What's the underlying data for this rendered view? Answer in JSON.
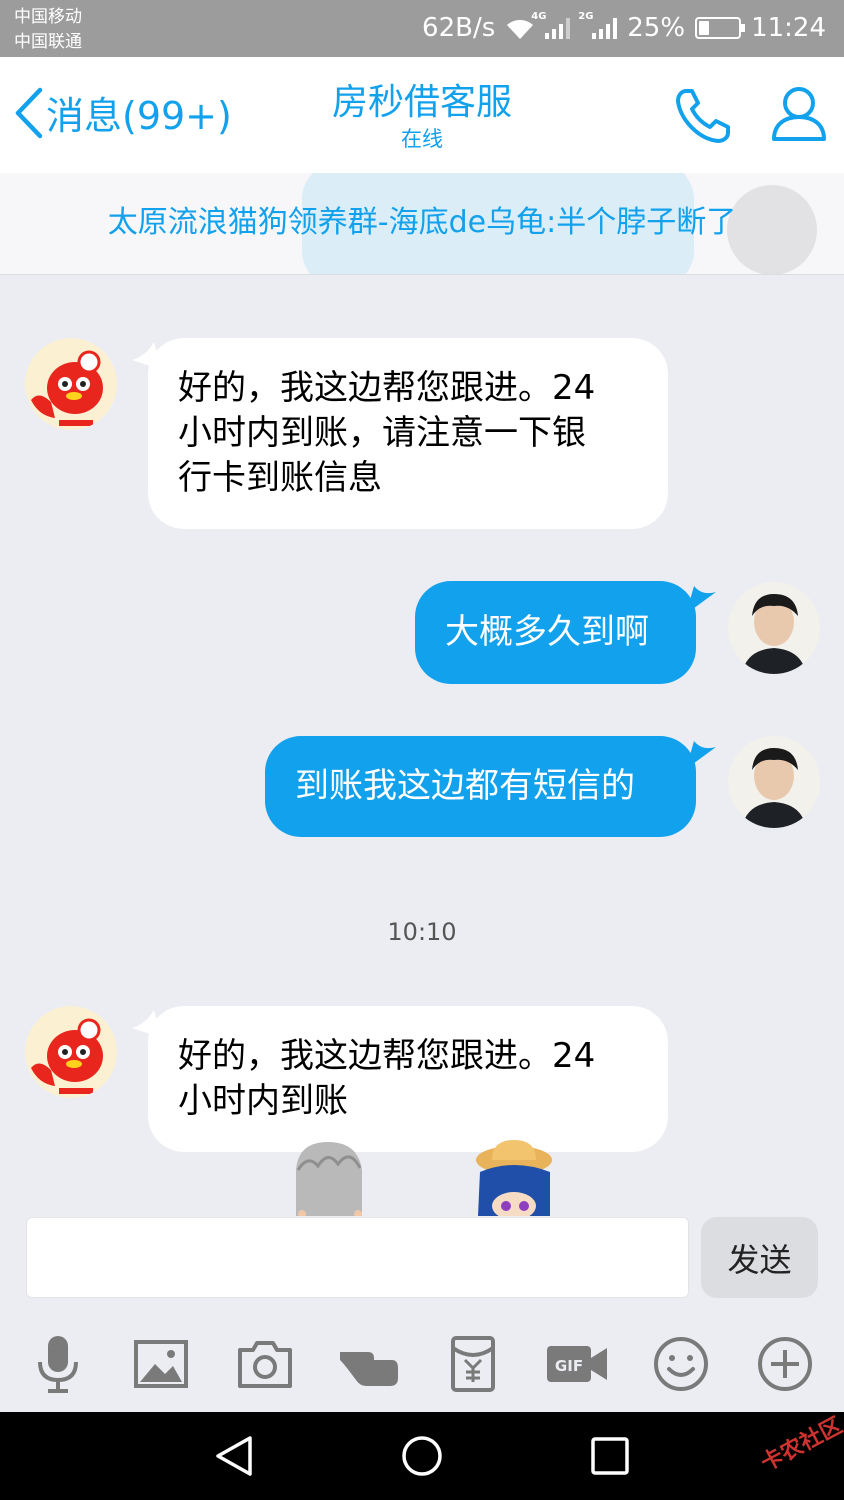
{
  "status_bar": {
    "carrier_1": "中国移动",
    "carrier_2": "中国联通",
    "net_speed": "62B/s",
    "net_tag_1": "4G",
    "net_tag_2": "2G",
    "battery": "25%",
    "battery_level": 0.25,
    "time": "11:24"
  },
  "header": {
    "back_label": "消息(99+)",
    "title": "房秒借客服",
    "subtitle": "在线"
  },
  "banner": {
    "text": "太原流浪猫狗领养群-海底de乌龟:半个脖子断了"
  },
  "messages": [
    {
      "side": "left",
      "text_lines": [
        "好的，我这边帮您跟进。24",
        "小时内到账，请注意一下银",
        "行卡到账信息"
      ]
    },
    {
      "side": "right",
      "text": "大概多久到啊"
    },
    {
      "side": "right",
      "text": "到账我这边都有短信的"
    },
    {
      "side": "left",
      "text_lines": [
        "好的，我这边帮您跟进。24",
        "小时内到账"
      ]
    }
  ],
  "timestamp": "10:10",
  "input": {
    "placeholder": "",
    "value": ""
  },
  "send_label": "发送",
  "watermark": "卡农社区",
  "colors": {
    "accent": "#12a1ec",
    "status_bar": "#9c9c9c",
    "chat_bg": "#ebedf2"
  }
}
